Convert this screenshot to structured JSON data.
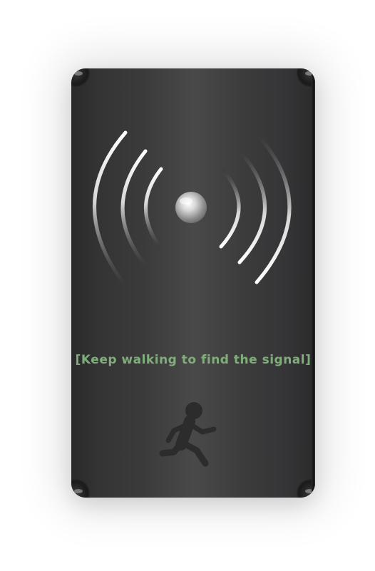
{
  "hint": {
    "text": "[Keep walking to find the signal]"
  },
  "icons": {
    "signal": "signal-waves-icon",
    "beacon": "beacon-dot-icon",
    "walker": "walking-person-icon"
  },
  "colors": {
    "hint_text": "#7fae7a",
    "device_body": "#3c3b3c",
    "walker_silhouette": "#2c2c2d"
  }
}
